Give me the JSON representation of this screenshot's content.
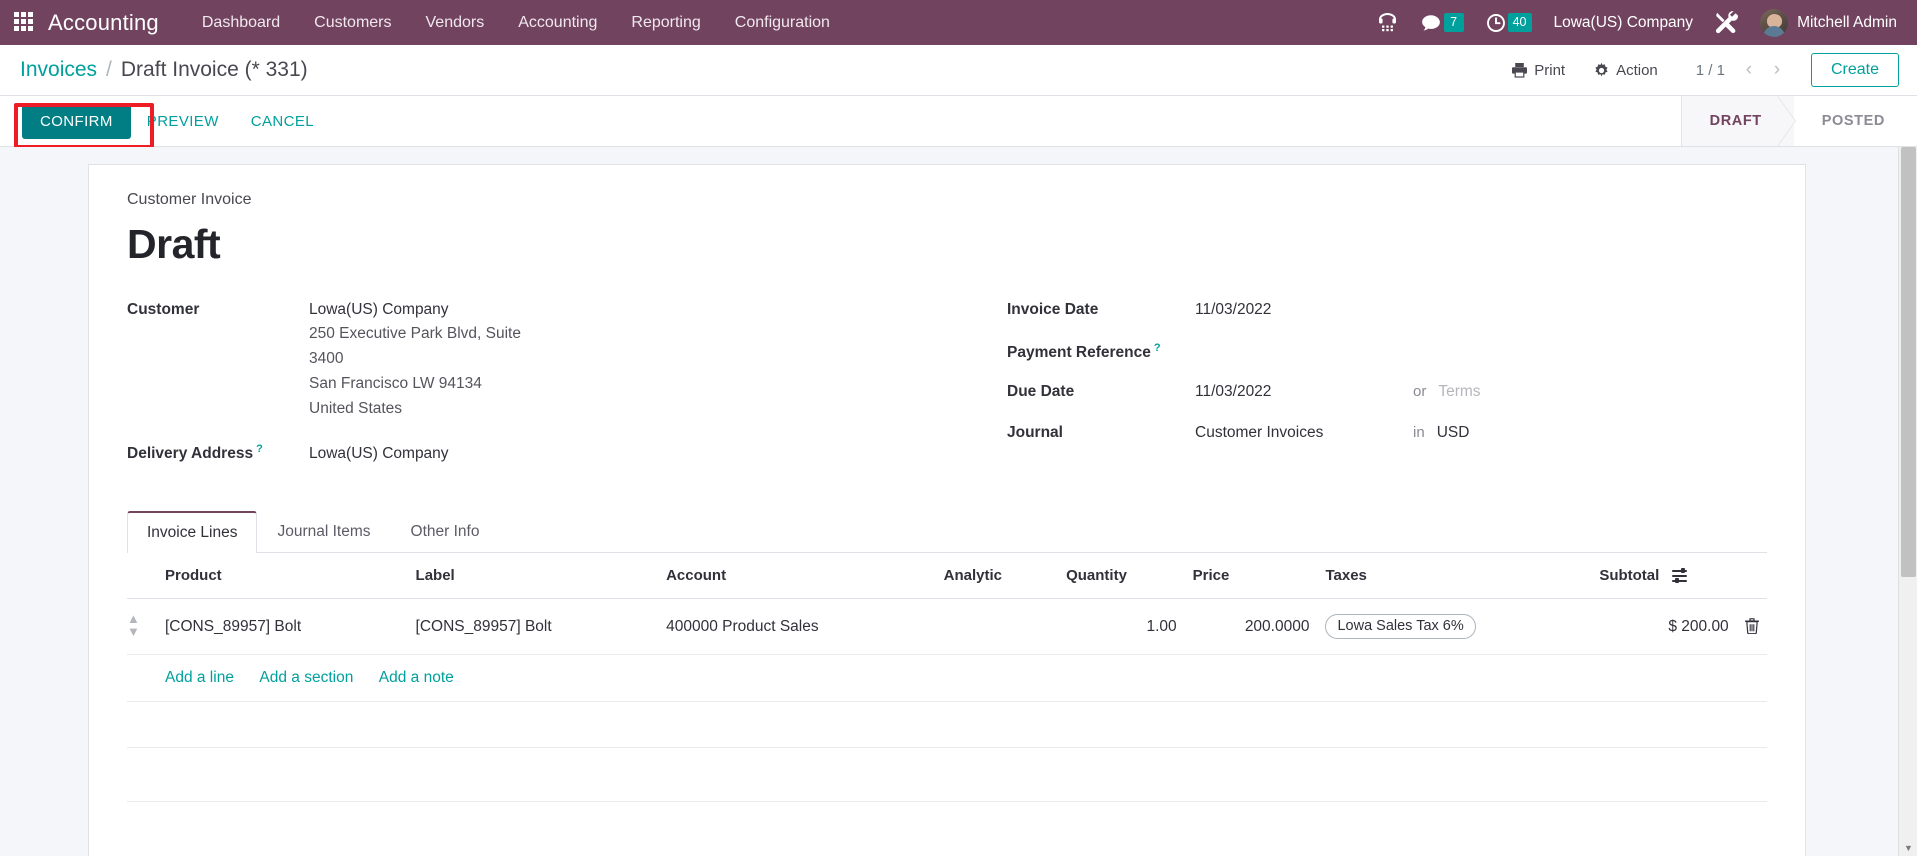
{
  "navbar": {
    "apps_icon": "apps-grid-icon",
    "brand": "Accounting",
    "menu": [
      {
        "label": "Dashboard"
      },
      {
        "label": "Customers"
      },
      {
        "label": "Vendors"
      },
      {
        "label": "Accounting"
      },
      {
        "label": "Reporting"
      },
      {
        "label": "Configuration"
      }
    ],
    "phone_icon": "phone-dialpad-icon",
    "messages": {
      "icon": "chat-bubble-icon",
      "count": "7"
    },
    "activities": {
      "icon": "clock-icon",
      "count": "40"
    },
    "company": "Lowa(US) Company",
    "tools_icon": "tools-icon",
    "user": {
      "name": "Mitchell Admin",
      "avatar": "user-avatar"
    }
  },
  "control_panel": {
    "breadcrumb_root": "Invoices",
    "breadcrumb_sep": "/",
    "breadcrumb_current": "Draft Invoice (* 331)",
    "print_label": "Print",
    "print_icon": "printer-icon",
    "action_label": "Action",
    "action_icon": "gear-icon",
    "pager": "1 / 1",
    "prev_icon": "chevron-left-icon",
    "next_icon": "chevron-right-icon",
    "create_label": "Create"
  },
  "statusbar": {
    "buttons": [
      {
        "label": "CONFIRM",
        "style": "primary",
        "highlighted": true
      },
      {
        "label": "PREVIEW",
        "style": "text"
      },
      {
        "label": "CANCEL",
        "style": "text"
      }
    ],
    "states": [
      {
        "label": "DRAFT",
        "active": true
      },
      {
        "label": "POSTED",
        "active": false
      }
    ],
    "highlight_color": "#ee1c25"
  },
  "form": {
    "subtitle": "Customer Invoice",
    "title": "Draft",
    "left": {
      "customer_label": "Customer",
      "customer_name": "Lowa(US) Company",
      "customer_address": [
        "250 Executive Park Blvd, Suite",
        "3400",
        "San Francisco LW 94134",
        "United States"
      ],
      "delivery_label": "Delivery Address",
      "delivery_tip": "?",
      "delivery_value": "Lowa(US) Company"
    },
    "right": {
      "invoice_date_label": "Invoice Date",
      "invoice_date_value": "11/03/2022",
      "payment_ref_label": "Payment Reference",
      "payment_ref_tip": "?",
      "payment_ref_value": "",
      "due_date_label": "Due Date",
      "due_date_value": "11/03/2022",
      "due_conj": "or",
      "terms_placeholder": "Terms",
      "journal_label": "Journal",
      "journal_value": "Customer Invoices",
      "currency_conj": "in",
      "currency_value": "USD"
    }
  },
  "notebook": {
    "tabs": [
      {
        "label": "Invoice Lines",
        "active": true
      },
      {
        "label": "Journal Items",
        "active": false
      },
      {
        "label": "Other Info",
        "active": false
      }
    ]
  },
  "lines_table": {
    "columns": [
      "Product",
      "Label",
      "Account",
      "Analytic",
      "Quantity",
      "Price",
      "Taxes",
      "Subtotal"
    ],
    "options_icon": "column-options-icon",
    "rows": [
      {
        "handle": "drag-handle-icon",
        "product": "[CONS_89957] Bolt",
        "label": "[CONS_89957] Bolt",
        "account": "400000 Product Sales",
        "analytic": "",
        "quantity": "1.00",
        "price": "200.0000",
        "taxes": "Lowa Sales Tax 6%",
        "subtotal": "$ 200.00",
        "delete_icon": "trash-icon"
      }
    ],
    "add_links": [
      {
        "label": "Add a line"
      },
      {
        "label": "Add a section"
      },
      {
        "label": "Add a note"
      }
    ]
  },
  "colors": {
    "navbar_bg": "#71435f",
    "accent_teal": "#00a09d",
    "confirm_teal": "#017e84",
    "highlight_red": "#ee1c25",
    "sheet_bg": "#ffffff",
    "page_bg": "#f5f6fa"
  }
}
